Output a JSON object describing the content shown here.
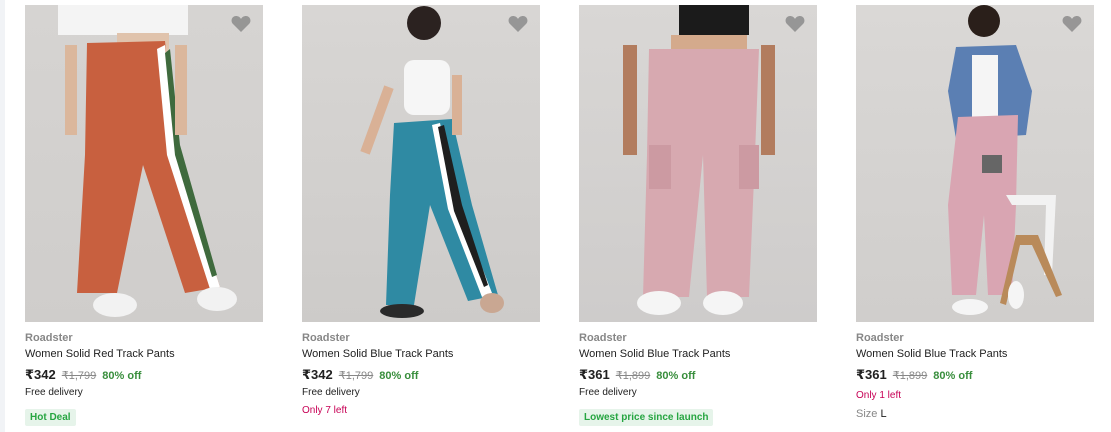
{
  "products": [
    {
      "brand": "Roadster",
      "title": "Women Solid Red Track Pants",
      "price": "₹342",
      "mrp": "₹1,799",
      "discount": "80% off",
      "delivery": "Free delivery",
      "tag": "Hot Deal",
      "tag_type": "green"
    },
    {
      "brand": "Roadster",
      "title": "Women Solid Blue Track Pants",
      "price": "₹342",
      "mrp": "₹1,799",
      "discount": "80% off",
      "delivery": "Free delivery",
      "tag": "Only 7 left",
      "tag_type": "red"
    },
    {
      "brand": "Roadster",
      "title": "Women Solid Blue Track Pants",
      "price": "₹361",
      "mrp": "₹1,899",
      "discount": "80% off",
      "delivery": "Free delivery",
      "tag": "Lowest price since launch",
      "tag_type": "green"
    },
    {
      "brand": "Roadster",
      "title": "Women Solid Blue Track Pants",
      "price": "₹361",
      "mrp": "₹1,899",
      "discount": "80% off",
      "delivery": "",
      "tag": "Only 1 left",
      "tag_type": "red",
      "size_label": "Size",
      "size_value": "L"
    }
  ],
  "icons": {
    "wishlist": "heart-icon"
  },
  "colors": {
    "discount": "#388e3c",
    "stock_warning": "#c70055",
    "tag_bg": "#e6f4ea"
  }
}
